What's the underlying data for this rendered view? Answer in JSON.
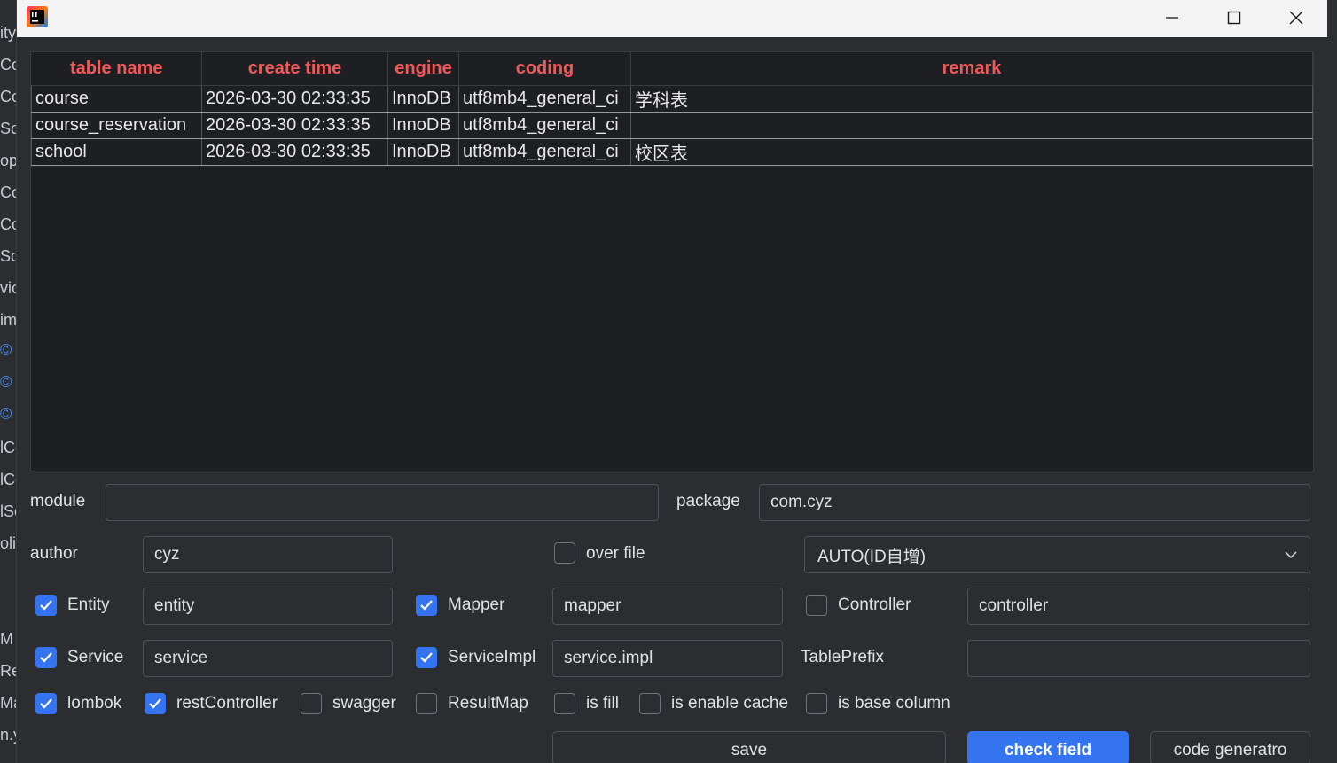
{
  "background_ide": {
    "fragments": [
      "ity",
      "Co",
      "Co",
      "Sc",
      "op",
      "Co",
      "Co",
      "Sc",
      "vic",
      "im",
      "©",
      "©",
      "©",
      "lCo",
      "lCo",
      "lSc",
      "oli",
      "M",
      "Re",
      "Ma",
      "n.y"
    ]
  },
  "window": {
    "controls": {
      "minimize": "—",
      "maximize": "☐",
      "close": "✕"
    }
  },
  "table": {
    "columns": [
      "table name",
      "create time",
      "engine",
      "coding",
      "remark"
    ],
    "rows": [
      [
        "course",
        "2026-03-30 02:33:35",
        "InnoDB",
        "utf8mb4_general_ci",
        "学科表"
      ],
      [
        "course_reservation",
        "2026-03-30 02:33:35",
        "InnoDB",
        "utf8mb4_general_ci",
        ""
      ],
      [
        "school",
        "2026-03-30 02:33:35",
        "InnoDB",
        "utf8mb4_general_ci",
        "校区表"
      ]
    ]
  },
  "form": {
    "module": {
      "label": "module",
      "value": ""
    },
    "package": {
      "label": "package",
      "value": "com.cyz"
    },
    "author": {
      "label": "author",
      "value": "cyz"
    },
    "over_file": {
      "label": "over file",
      "checked": false
    },
    "id_type": {
      "selected": "AUTO(ID自增)"
    },
    "entity": {
      "label": "Entity",
      "checked": true,
      "value": "entity"
    },
    "mapper": {
      "label": "Mapper",
      "checked": true,
      "value": "mapper"
    },
    "controller": {
      "label": "Controller",
      "checked": false,
      "value": "controller"
    },
    "service": {
      "label": "Service",
      "checked": true,
      "value": "service"
    },
    "service_impl": {
      "label": "ServiceImpl",
      "checked": true,
      "value": "service.impl"
    },
    "table_prefix": {
      "label": "TablePrefix",
      "value": ""
    },
    "options": {
      "lombok": {
        "label": "lombok",
        "checked": true
      },
      "rest_controller": {
        "label": "restController",
        "checked": true
      },
      "swagger": {
        "label": "swagger",
        "checked": false
      },
      "result_map": {
        "label": "ResultMap",
        "checked": false
      },
      "is_fill": {
        "label": "is fill",
        "checked": false
      },
      "is_enable_cache": {
        "label": "is enable cache",
        "checked": false
      },
      "is_base_column": {
        "label": "is base column",
        "checked": false
      }
    }
  },
  "buttons": {
    "save": "save",
    "check_field": "check field",
    "code_generator": "code generatro"
  },
  "colors": {
    "header_text": "#f0595a",
    "accent": "#3574f0",
    "panel": "#2b2d30",
    "table_bg": "#1e1f22"
  }
}
